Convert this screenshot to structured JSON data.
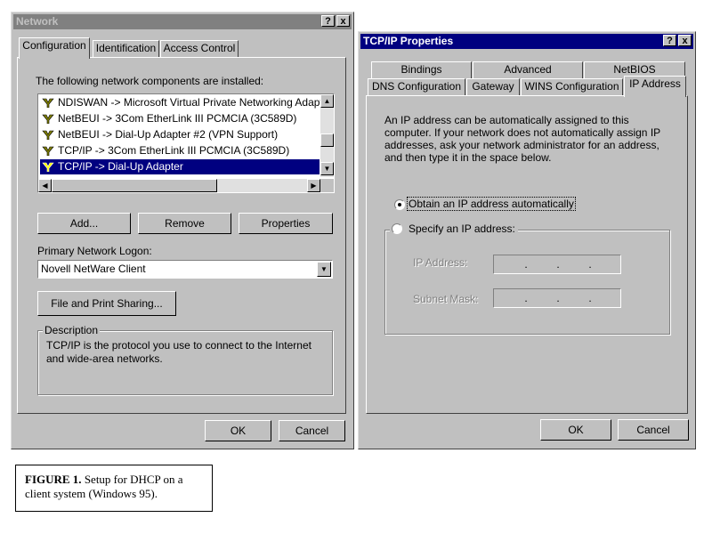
{
  "network": {
    "title": "Network",
    "tabs": [
      "Configuration",
      "Identification",
      "Access Control"
    ],
    "components_label": "The following network components are installed:",
    "components": [
      "NDISWAN -> Microsoft Virtual Private Networking Adapter",
      "NetBEUI -> 3Com EtherLink III PCMCIA (3C589D)",
      "NetBEUI -> Dial-Up Adapter #2 (VPN Support)",
      "TCP/IP -> 3Com EtherLink III PCMCIA (3C589D)",
      "TCP/IP -> Dial-Up Adapter"
    ],
    "selected_component_index": 4,
    "add_button": "Add...",
    "remove_button": "Remove",
    "properties_button": "Properties",
    "logon_label": "Primary Network Logon:",
    "logon_value": "Novell NetWare Client",
    "file_print_button": "File and Print Sharing...",
    "description_label": "Description",
    "description_text": "TCP/IP is the protocol you use to connect to the Internet and wide-area networks.",
    "ok_button": "OK",
    "cancel_button": "Cancel"
  },
  "tcpip": {
    "title": "TCP/IP Properties",
    "tabs_row1": [
      "Bindings",
      "Advanced",
      "NetBIOS"
    ],
    "tabs_row2": [
      "DNS Configuration",
      "Gateway",
      "WINS Configuration",
      "IP Address"
    ],
    "intro_text": "An IP address can be automatically assigned to this computer. If your network does not automatically assign IP addresses, ask your network administrator for an address, and then type it in the space below.",
    "obtain_label": "Obtain an IP address automatically",
    "specify_label": "Specify an IP address:",
    "ip_address_label": "IP Address:",
    "subnet_mask_label": "Subnet Mask:",
    "ok_button": "OK",
    "cancel_button": "Cancel",
    "selected_option": "obtain"
  },
  "caption": {
    "label": "FIGURE 1.",
    "text": "Setup for DHCP on a client system (Windows 95)."
  },
  "icons": {
    "help": "?",
    "close": "x",
    "component": "network-component-icon"
  }
}
